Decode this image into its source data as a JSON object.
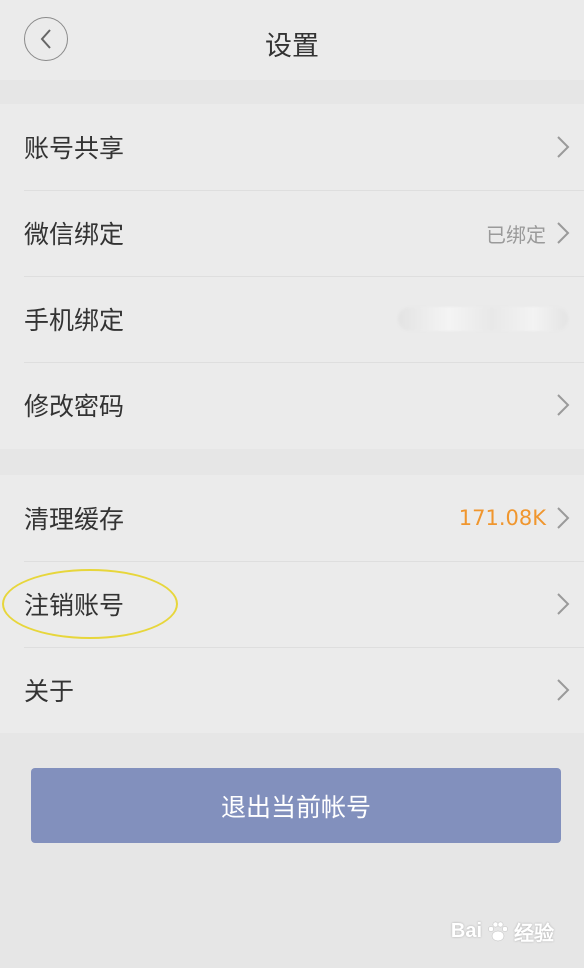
{
  "header": {
    "title": "设置",
    "back_icon": "chevron-left-icon"
  },
  "group1": [
    {
      "label": "账号共享",
      "value": ""
    },
    {
      "label": "微信绑定",
      "value": "已绑定"
    },
    {
      "label": "手机绑定",
      "value": ""
    },
    {
      "label": "修改密码",
      "value": ""
    }
  ],
  "group2": [
    {
      "label": "清理缓存",
      "value": "171.08K"
    },
    {
      "label": "注销账号",
      "value": ""
    },
    {
      "label": "关于",
      "value": ""
    }
  ],
  "logout": {
    "label": "退出当前帐号"
  },
  "colors": {
    "accent_orange": "#f0962e",
    "button_bg": "#8290bd",
    "highlight_ring": "#e7d63b"
  },
  "watermark": {
    "left": "Bai",
    "right": "经验"
  }
}
